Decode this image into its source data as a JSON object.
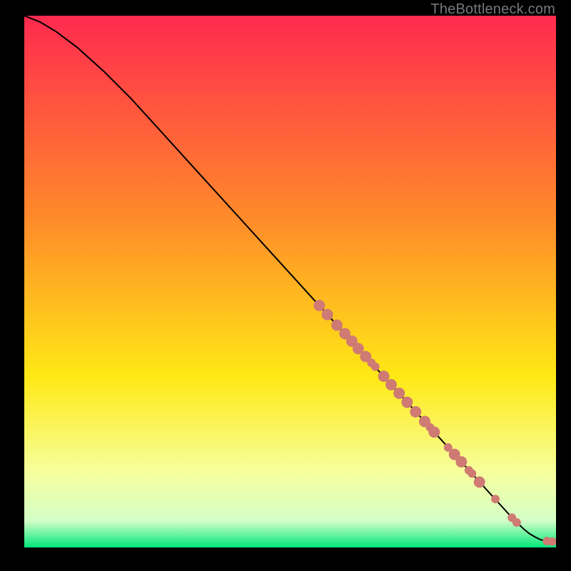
{
  "attribution": "TheBottleneck.com",
  "colors": {
    "background": "#000000",
    "gradient_top": "#ff2a4f",
    "gradient_mid1": "#ff8a2a",
    "gradient_mid2": "#ffe915",
    "gradient_mid3": "#f6ff9e",
    "gradient_mid4": "#d4ffc7",
    "gradient_bottom": "#00e77a",
    "curve": "#000000",
    "dots": "#cf7b74"
  },
  "chart_data": {
    "type": "line",
    "title": "",
    "xlabel": "",
    "ylabel": "",
    "xlim": [
      0,
      100
    ],
    "ylim": [
      0,
      100
    ],
    "grid": false,
    "series": [
      {
        "name": "curve",
        "x": [
          0,
          3,
          6,
          10,
          15,
          20,
          30,
          40,
          50,
          55,
          60,
          65,
          70,
          75,
          80,
          85,
          90,
          92,
          94,
          95,
          96,
          97,
          98,
          99,
          100
        ],
        "y": [
          100,
          98.8,
          97.0,
          94.0,
          89.5,
          84.5,
          73.5,
          62.5,
          51.5,
          46.0,
          40.5,
          35.0,
          29.5,
          24.0,
          18.5,
          13.0,
          7.5,
          5.3,
          3.4,
          2.6,
          2.0,
          1.5,
          1.2,
          1.1,
          1.0
        ]
      }
    ],
    "points": [
      {
        "x": 55.5,
        "y": 45.5,
        "r": 1.07
      },
      {
        "x": 57.0,
        "y": 43.8,
        "r": 1.07
      },
      {
        "x": 58.8,
        "y": 41.8,
        "r": 1.07
      },
      {
        "x": 60.3,
        "y": 40.2,
        "r": 1.07
      },
      {
        "x": 61.6,
        "y": 38.8,
        "r": 1.07
      },
      {
        "x": 62.8,
        "y": 37.4,
        "r": 1.07
      },
      {
        "x": 64.2,
        "y": 35.9,
        "r": 1.07
      },
      {
        "x": 65.3,
        "y": 34.7,
        "r": 0.8
      },
      {
        "x": 66.0,
        "y": 34.0,
        "r": 0.8
      },
      {
        "x": 67.6,
        "y": 32.2,
        "r": 1.07
      },
      {
        "x": 69.0,
        "y": 30.6,
        "r": 1.07
      },
      {
        "x": 70.5,
        "y": 29.0,
        "r": 1.07
      },
      {
        "x": 72.0,
        "y": 27.3,
        "r": 1.07
      },
      {
        "x": 73.6,
        "y": 25.5,
        "r": 1.07
      },
      {
        "x": 75.3,
        "y": 23.7,
        "r": 1.07
      },
      {
        "x": 76.3,
        "y": 22.6,
        "r": 0.8
      },
      {
        "x": 77.1,
        "y": 21.7,
        "r": 1.07
      },
      {
        "x": 79.7,
        "y": 18.8,
        "r": 0.8
      },
      {
        "x": 80.9,
        "y": 17.5,
        "r": 1.07
      },
      {
        "x": 82.2,
        "y": 16.1,
        "r": 1.07
      },
      {
        "x": 83.6,
        "y": 14.5,
        "r": 0.8
      },
      {
        "x": 84.2,
        "y": 13.9,
        "r": 0.8
      },
      {
        "x": 85.6,
        "y": 12.3,
        "r": 1.07
      },
      {
        "x": 88.6,
        "y": 9.1,
        "r": 0.8
      },
      {
        "x": 91.7,
        "y": 5.6,
        "r": 0.8
      },
      {
        "x": 92.6,
        "y": 4.7,
        "r": 0.8
      },
      {
        "x": 98.3,
        "y": 1.2,
        "r": 0.8
      },
      {
        "x": 99.3,
        "y": 1.1,
        "r": 0.8
      }
    ]
  }
}
